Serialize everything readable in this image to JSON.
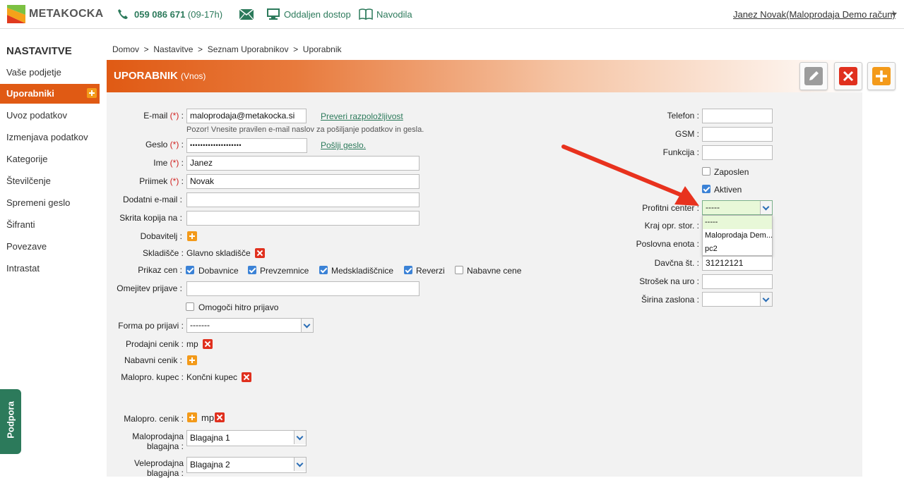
{
  "top": {
    "brand": "METAKOCKA",
    "phone": "059 086 671",
    "phone_hours": "(09-17h)",
    "remote": "Oddaljen dostop",
    "manuals": "Navodila",
    "user": "Janez Novak(Maloprodaja Demo račun)"
  },
  "sidebar": {
    "title": "NASTAVITVE",
    "items": [
      {
        "label": "Vaše podjetje"
      },
      {
        "label": "Uporabniki"
      },
      {
        "label": "Uvoz podatkov"
      },
      {
        "label": "Izmenjava podatkov"
      },
      {
        "label": "Kategorije"
      },
      {
        "label": "Številčenje"
      },
      {
        "label": "Spremeni geslo"
      },
      {
        "label": "Šifranti"
      },
      {
        "label": "Povezave"
      },
      {
        "label": "Intrastat"
      }
    ],
    "support": "Podpora"
  },
  "breadcrumb": "Domov  >  Nastavitve  >  Seznam Uporabnikov  >  Uporabnik",
  "header": {
    "title": "UPORABNIK",
    "subtitle": "(Vnos)"
  },
  "form": {
    "req": "(*)",
    "email_label": "E-mail",
    "email_value": "maloprodaja@metakocka.si",
    "check_link": "Preveri razpoložljivost",
    "email_hint": "Pozor! Vnesite pravilen e-mail naslov za pošiljanje podatkov in gesla.",
    "password_label": "Geslo",
    "password_value": "••••••••••••••••••••",
    "send_link": "Pošlji geslo.",
    "name_label": "Ime",
    "name_value": "Janez",
    "surname_label": "Priimek",
    "surname_value": "Novak",
    "extra_email_label": "Dodatni e-mail :",
    "bcc_label": "Skrita kopija na :",
    "supplier_label": "Dobavitelj :",
    "warehouse_label": "Skladišče :",
    "warehouse_value": "Glavno skladišče",
    "prices_label": "Prikaz cen :",
    "prices": [
      {
        "label": "Dobavnice",
        "checked": true
      },
      {
        "label": "Prevzemnice",
        "checked": true
      },
      {
        "label": "Medskladiščnice",
        "checked": true
      },
      {
        "label": "Reverzi",
        "checked": true
      },
      {
        "label": "Nabavne cene",
        "checked": false
      }
    ],
    "login_limit_label": "Omejitev prijave :",
    "quick_login": "Omogoči hitro prijavo",
    "form_after_login_label": "Forma po prijavi :",
    "form_after_login_value": "-------",
    "sales_pricelist_label": "Prodajni cenik :",
    "sales_pricelist_value": "mp",
    "purchase_pricelist_label": "Nabavni cenik :",
    "retail_customer_label": "Malopro. kupec :",
    "retail_customer_value": "Končni kupec",
    "retail_pricelist_label": "Malopro. cenik :",
    "retail_pricelist_value": "mp",
    "retail_register_label_1": "Maloprodajna",
    "retail_register_label_2": "blagajna :",
    "retail_register_value": "Blagajna 1",
    "wholesale_register_label_1": "Veleprodajna",
    "wholesale_register_label_2": "blagajna :",
    "wholesale_register_value": "Blagajna 2"
  },
  "right": {
    "phone_label": "Telefon :",
    "gsm_label": "GSM :",
    "function_label": "Funkcija :",
    "employed_label": "Zaposlen",
    "active_label": "Aktiven",
    "profit_center_label": "Profitni center :",
    "profit_center_value": "-----",
    "profit_center_options": [
      "-----",
      "Maloprodaja Dem...",
      "pc2"
    ],
    "warehouse_end_label": "Kraj opr. stor. :",
    "business_unit_label": "Poslovna enota :",
    "tax_no_label": "Davčna št. :",
    "tax_no_value": "31212121",
    "hourly_cost_label": "Strošek na uro :",
    "screen_width_label": "Širina zaslona :"
  }
}
